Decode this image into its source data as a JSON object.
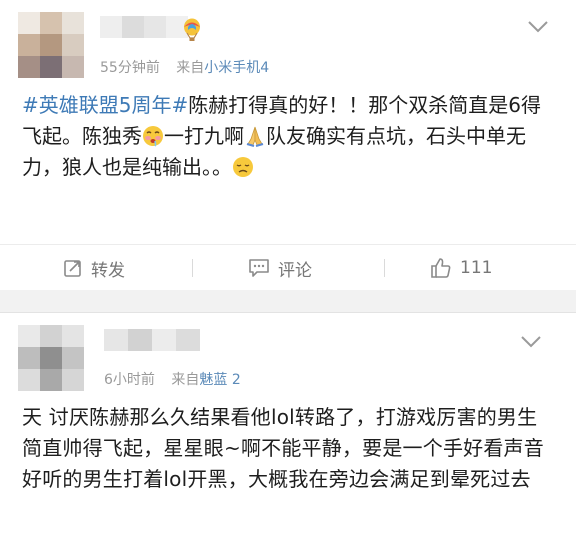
{
  "posts": [
    {
      "time": "55分钟前",
      "source_prefix": "来自",
      "source": "小米手机4",
      "segments": [
        {
          "type": "hashtag",
          "text": "#英雄联盟5周年#"
        },
        {
          "type": "text",
          "text": "陈赫打得真的好！！那个双杀简直是6得飞起。陈独秀"
        },
        {
          "type": "emoji",
          "name": "drooling-face-emoji"
        },
        {
          "type": "text",
          "text": "一打九啊"
        },
        {
          "type": "emoji",
          "name": "praying-hands-emoji"
        },
        {
          "type": "text",
          "text": "队友确实有点坑，石头中单无力，狼人也是纯输出。。"
        },
        {
          "type": "emoji",
          "name": "disappointed-face-emoji"
        }
      ],
      "actions": {
        "repost_label": "转发",
        "comment_label": "评论",
        "like_count": "111"
      }
    },
    {
      "time": "6小时前",
      "source_prefix": "来自",
      "source": "魅蓝 2",
      "segments": [
        {
          "type": "text",
          "text": "天 讨厌陈赫那么久结果看他lol转路了，打游戏厉害的男生简直帅得飞起，星星眼~啊不能平静，要是一个手好看声音好听的男生打着lol开黑，大概我在旁边会满足到晕死过去"
        }
      ]
    }
  ],
  "colors": {
    "hashtag": "#3e7ab6",
    "source_link": "#5b8ab8",
    "meta_text": "#9a9a9a",
    "body_text": "#1e1e1e"
  },
  "icons": [
    "fire-balloon-icon",
    "chevron-down-icon",
    "repost-icon",
    "comment-icon",
    "thumbs-up-icon"
  ]
}
